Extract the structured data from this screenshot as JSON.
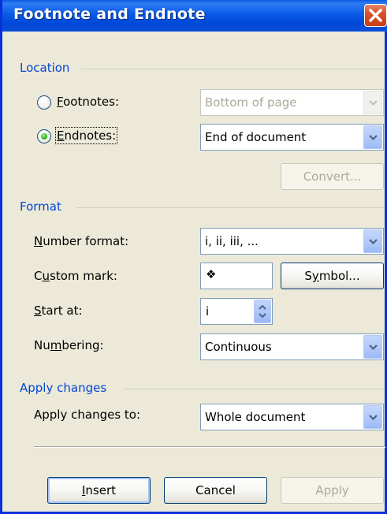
{
  "window": {
    "title": "Footnote and Endnote"
  },
  "location": {
    "group_label": "Location",
    "footnotes": {
      "label": "Footnotes:",
      "selected": false,
      "value": "Bottom of page",
      "enabled": false
    },
    "endnotes": {
      "label": "Endnotes:",
      "selected": true,
      "value": "End of document",
      "enabled": true
    },
    "convert_label": "Convert..."
  },
  "format": {
    "group_label": "Format",
    "number_format": {
      "label": "Number format:",
      "value": "i, ii, iii, ..."
    },
    "custom_mark": {
      "label": "Custom mark:",
      "value": "❖"
    },
    "symbol_label": "Symbol...",
    "start_at": {
      "label": "Start at:",
      "value": "i"
    },
    "numbering": {
      "label": "Numbering:",
      "value": "Continuous"
    }
  },
  "apply_changes": {
    "group_label": "Apply changes",
    "apply_to": {
      "label": "Apply changes to:",
      "value": "Whole document"
    }
  },
  "buttons": {
    "insert": "Insert",
    "cancel": "Cancel",
    "apply": "Apply"
  },
  "colors": {
    "title_bar": "#0a5ae8",
    "group_label": "#0046d5",
    "dialog_bg": "#ece9d8",
    "close_button": "#d9502a"
  }
}
